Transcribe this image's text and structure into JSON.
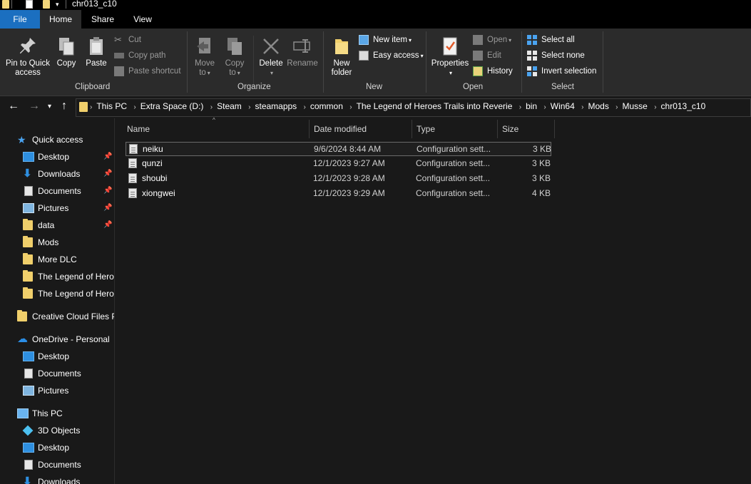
{
  "window": {
    "title": "chr013_c10"
  },
  "tabs": [
    {
      "label": "File"
    },
    {
      "label": "Home"
    },
    {
      "label": "Share"
    },
    {
      "label": "View"
    }
  ],
  "ribbon": {
    "clipboard": {
      "group_label": "Clipboard",
      "pin_label_1": "Pin to Quick",
      "pin_label_2": "access",
      "copy": "Copy",
      "paste": "Paste",
      "cut": "Cut",
      "copy_path": "Copy path",
      "paste_shortcut": "Paste shortcut"
    },
    "organize": {
      "group_label": "Organize",
      "move_to_1": "Move",
      "move_to_2": "to",
      "copy_to_1": "Copy",
      "copy_to_2": "to",
      "delete": "Delete",
      "rename": "Rename"
    },
    "new": {
      "group_label": "New",
      "new_folder_1": "New",
      "new_folder_2": "folder",
      "new_item": "New item",
      "easy_access": "Easy access"
    },
    "open": {
      "group_label": "Open",
      "properties": "Properties",
      "open": "Open",
      "edit": "Edit",
      "history": "History"
    },
    "select": {
      "group_label": "Select",
      "select_all": "Select all",
      "select_none": "Select none",
      "invert_selection": "Invert selection"
    }
  },
  "breadcrumb": [
    "This PC",
    "Extra Space (D:)",
    "Steam",
    "steamapps",
    "common",
    "The Legend of Heroes Trails into Reverie",
    "bin",
    "Win64",
    "Mods",
    "Musse",
    "chr013_c10"
  ],
  "sidebar": {
    "quick_access": "Quick access",
    "qa_items": [
      {
        "label": "Desktop",
        "icon": "desktop-icon",
        "pinned": true
      },
      {
        "label": "Downloads",
        "icon": "downloads-icon",
        "pinned": true
      },
      {
        "label": "Documents",
        "icon": "documents-icon",
        "pinned": true
      },
      {
        "label": "Pictures",
        "icon": "pictures-icon",
        "pinned": true
      },
      {
        "label": "data",
        "icon": "folder-icon",
        "pinned": true
      },
      {
        "label": "Mods",
        "icon": "folder-icon",
        "pinned": false
      },
      {
        "label": "More DLC",
        "icon": "folder-icon",
        "pinned": false
      },
      {
        "label": "The Legend of Hero",
        "icon": "folder-icon",
        "pinned": false
      },
      {
        "label": "The Legend of Hero",
        "icon": "folder-icon",
        "pinned": false
      }
    ],
    "creative_cloud": "Creative Cloud Files P",
    "onedrive": "OneDrive - Personal",
    "od_items": [
      {
        "label": "Desktop"
      },
      {
        "label": "Documents"
      },
      {
        "label": "Pictures"
      }
    ],
    "this_pc": "This PC",
    "pc_items": [
      {
        "label": "3D Objects"
      },
      {
        "label": "Desktop"
      },
      {
        "label": "Documents"
      },
      {
        "label": "Downloads"
      }
    ]
  },
  "columns": {
    "name": "Name",
    "date_modified": "Date modified",
    "type": "Type",
    "size": "Size"
  },
  "files": [
    {
      "name": "neiku",
      "date": "9/6/2024 8:44 AM",
      "type": "Configuration sett...",
      "size": "3 KB",
      "selected": true
    },
    {
      "name": "qunzi",
      "date": "12/1/2023 9:27 AM",
      "type": "Configuration sett...",
      "size": "3 KB",
      "selected": false
    },
    {
      "name": "shoubi",
      "date": "12/1/2023 9:28 AM",
      "type": "Configuration sett...",
      "size": "3 KB",
      "selected": false
    },
    {
      "name": "xiongwei",
      "date": "12/1/2023 9:29 AM",
      "type": "Configuration sett...",
      "size": "4 KB",
      "selected": false
    }
  ],
  "colors": {
    "file_tab": "#1b6fc0",
    "background": "#191919",
    "ribbon": "#2b2b2b",
    "folder": "#f0cf6b"
  }
}
